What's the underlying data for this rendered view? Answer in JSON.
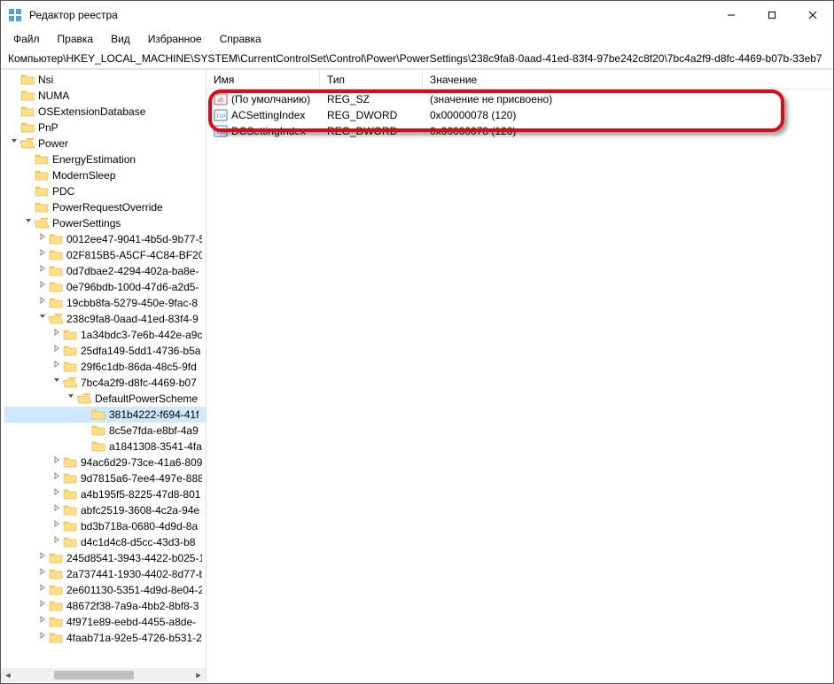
{
  "window": {
    "title": "Редактор реестра"
  },
  "menu": {
    "file": "Файл",
    "edit": "Правка",
    "view": "Вид",
    "favorites": "Избранное",
    "help": "Справка"
  },
  "path": "Компьютер\\HKEY_LOCAL_MACHINE\\SYSTEM\\CurrentControlSet\\Control\\Power\\PowerSettings\\238c9fa8-0aad-41ed-83f4-97be242c8f20\\7bc4a2f9-d8fc-4469-b07b-33eb7",
  "columns": {
    "name": "Имя",
    "type": "Тип",
    "value": "Значение"
  },
  "values": [
    {
      "icon": "string",
      "name": "(По умолчанию)",
      "type": "REG_SZ",
      "value": "(значение не присвоено)"
    },
    {
      "icon": "dword",
      "name": "ACSettingIndex",
      "type": "REG_DWORD",
      "value": "0x00000078 (120)"
    },
    {
      "icon": "dword",
      "name": "DCSettingIndex",
      "type": "REG_DWORD",
      "value": "0x00000078 (120)"
    }
  ],
  "tree": [
    {
      "depth": 0,
      "exp": "",
      "label": "Nsi"
    },
    {
      "depth": 0,
      "exp": "",
      "label": "NUMA"
    },
    {
      "depth": 0,
      "exp": "",
      "label": "OSExtensionDatabase"
    },
    {
      "depth": 0,
      "exp": "",
      "label": "PnP"
    },
    {
      "depth": 0,
      "exp": "open",
      "label": "Power"
    },
    {
      "depth": 1,
      "exp": "",
      "label": "EnergyEstimation"
    },
    {
      "depth": 1,
      "exp": "",
      "label": "ModernSleep"
    },
    {
      "depth": 1,
      "exp": "",
      "label": "PDC"
    },
    {
      "depth": 1,
      "exp": "",
      "label": "PowerRequestOverride"
    },
    {
      "depth": 1,
      "exp": "open",
      "label": "PowerSettings"
    },
    {
      "depth": 2,
      "exp": "closed",
      "label": "0012ee47-9041-4b5d-9b77-5"
    },
    {
      "depth": 2,
      "exp": "closed",
      "label": "02F815B5-A5CF-4C84-BF20-"
    },
    {
      "depth": 2,
      "exp": "closed",
      "label": "0d7dbae2-4294-402a-ba8e-"
    },
    {
      "depth": 2,
      "exp": "closed",
      "label": "0e796bdb-100d-47d6-a2d5-"
    },
    {
      "depth": 2,
      "exp": "closed",
      "label": "19cbb8fa-5279-450e-9fac-8"
    },
    {
      "depth": 2,
      "exp": "open",
      "label": "238c9fa8-0aad-41ed-83f4-9"
    },
    {
      "depth": 3,
      "exp": "closed",
      "label": "1a34bdc3-7e6b-442e-a9c"
    },
    {
      "depth": 3,
      "exp": "closed",
      "label": "25dfa149-5dd1-4736-b5a"
    },
    {
      "depth": 3,
      "exp": "closed",
      "label": "29f6c1db-86da-48c5-9fd"
    },
    {
      "depth": 3,
      "exp": "open",
      "label": "7bc4a2f9-d8fc-4469-b07"
    },
    {
      "depth": 4,
      "exp": "open",
      "label": "DefaultPowerScheme"
    },
    {
      "depth": 5,
      "exp": "",
      "label": "381b4222-f694-41f",
      "selected": true
    },
    {
      "depth": 5,
      "exp": "",
      "label": "8c5e7fda-e8bf-4a9"
    },
    {
      "depth": 5,
      "exp": "",
      "label": "a1841308-3541-4fa"
    },
    {
      "depth": 3,
      "exp": "closed",
      "label": "94ac6d29-73ce-41a6-809"
    },
    {
      "depth": 3,
      "exp": "closed",
      "label": "9d7815a6-7ee4-497e-888"
    },
    {
      "depth": 3,
      "exp": "closed",
      "label": "a4b195f5-8225-47d8-801"
    },
    {
      "depth": 3,
      "exp": "closed",
      "label": "abfc2519-3608-4c2a-94e"
    },
    {
      "depth": 3,
      "exp": "closed",
      "label": "bd3b718a-0680-4d9d-8a"
    },
    {
      "depth": 3,
      "exp": "closed",
      "label": "d4c1d4c8-d5cc-43d3-b8"
    },
    {
      "depth": 2,
      "exp": "closed",
      "label": "245d8541-3943-4422-b025-1"
    },
    {
      "depth": 2,
      "exp": "closed",
      "label": "2a737441-1930-4402-8d77-b"
    },
    {
      "depth": 2,
      "exp": "closed",
      "label": "2e601130-5351-4d9d-8e04-2"
    },
    {
      "depth": 2,
      "exp": "closed",
      "label": "48672f38-7a9a-4bb2-8bf8-3"
    },
    {
      "depth": 2,
      "exp": "closed",
      "label": "4f971e89-eebd-4455-a8de-"
    },
    {
      "depth": 2,
      "exp": "closed",
      "label": "4faab71a-92e5-4726-b531-2"
    }
  ]
}
